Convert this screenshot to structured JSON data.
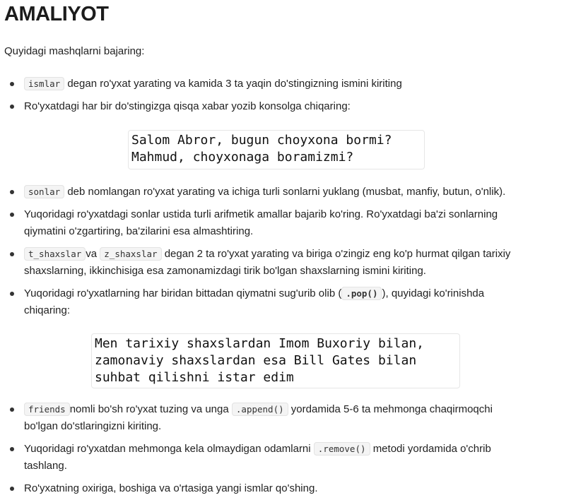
{
  "title": "AMALIYOT",
  "intro": "Quyidagi mashqlarni bajaring:",
  "items": [
    {
      "code": "ismlar",
      "text": "degan ro'yxat yarating va kamida 3 ta yaqin do'stingizning ismini kiriting"
    },
    {
      "text": "Ro'yxatdagi har bir do'stingizga qisqa xabar yozib konsolga chiqaring:"
    },
    {
      "code": "sonlar",
      "text": "deb nomlangan ro'yxat yarating va ichiga turli sonlarni yuklang (musbat, manfiy, butun, o'nlik)."
    },
    {
      "line1": "Yuqoridagi ro'yxatdagi sonlar ustida turli arifmetik amallar bajarib ko'ring. Ro'yxatdagi ba'zi sonlarning",
      "line2": "qiymatini o'zgartiring, ba'zilarini esa almashtiring."
    },
    {
      "code": "t_shaxslar",
      "mid": "va",
      "code2": "z_shaxslar",
      "text": "degan 2 ta ro'yxat yarating va biriga o'zingiz eng ko'p hurmat qilgan tarixiy",
      "line2": "shaxslarning, ikkinchisiga esa zamonamizdagi tirik bo'lgan shaxslarning ismini kiriting."
    },
    {
      "pre": "Yuqoridagi ro'yxatlarning har biridan bittadan qiymatni sug'urib olib (",
      "code": ".pop()",
      "post": "), quyidagi ko'rinishda",
      "line2": "chiqaring:"
    },
    {
      "code": "friends",
      "text": "nomli bo'sh ro'yxat tuzing va unga",
      "code2": ".append()",
      "post": "yordamida 5-6 ta mehmonga chaqirmoqchi",
      "line2": "bo'lgan do'stlaringizni kiriting."
    },
    {
      "pre": "Yuqoridagi ro'yxatdan mehmonga kela olmaydigan odamlarni",
      "code": ".remove()",
      "post": "metodi yordamida o'chrib",
      "line2": "tashlang."
    },
    {
      "text": "Ro'yxatning oxiriga, boshiga va o'rtasiga yangi ismlar qo'shing."
    }
  ],
  "code_block_1": [
    "Salom Abror, bugun choyxona bormi?",
    "Mahmud, choyxonaga boramizmi?"
  ],
  "code_block_2": [
    "Men tarixiy shaxslardan Imom Buxoriy bilan,",
    "zamonaviy shaxslardan esa Bill Gates bilan",
    "suhbat qilishni istar edim"
  ]
}
